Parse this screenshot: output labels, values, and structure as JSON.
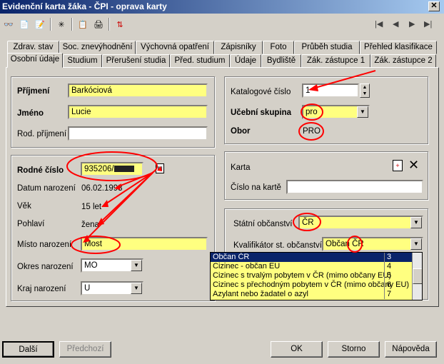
{
  "window": {
    "title": "Evidenční karta žáka - ČPI - oprava karty"
  },
  "toolbar": {
    "items": [
      "binoculars-icon",
      "copy-doc-icon",
      "edit-doc-icon",
      "asterisk-icon",
      "forms-icon",
      "print-icon",
      "swap-icon"
    ],
    "nav": [
      "|◀",
      "◀",
      "▶",
      "▶|"
    ]
  },
  "tabs": {
    "row1": [
      "Zdrav. stav",
      "Soc. znevýhodnění",
      "Výchovná opatření",
      "Zápisníky",
      "Foto",
      "Průběh studia",
      "Přehled klasifikace"
    ],
    "row2": [
      "Osobní údaje",
      "Studium",
      "Přerušení studia",
      "Před. studium",
      "Údaje",
      "Bydliště",
      "Zák. zástupce 1",
      "Zák. zástupce 2"
    ]
  },
  "name": {
    "surname_label": "Příjmení",
    "surname": "Barkóciová",
    "first_label": "Jméno",
    "first": "Lucie",
    "birthname_label": "Rod. příjmení",
    "birthname": ""
  },
  "birth": {
    "rc_label": "Rodné číslo",
    "rc": "935206/",
    "date_label": "Datum narození",
    "date": "06.02.1993",
    "age_label": "Věk",
    "age": "15 let",
    "sex_label": "Pohlaví",
    "sex": "žena",
    "place_label": "Místo narození",
    "place": "Most",
    "district_label": "Okres narození",
    "district": "MO",
    "region_label": "Kraj narození",
    "region": "U"
  },
  "catalog": {
    "num_label": "Katalogové číslo",
    "num": "1",
    "group_label": "Učební skupina",
    "group": "pro",
    "branch_label": "Obor",
    "branch": "PRO"
  },
  "card": {
    "label": "Karta",
    "num_label": "Číslo na kartě",
    "num": ""
  },
  "citizen": {
    "state_label": "Státní občanství",
    "state": "ČR",
    "qual_label": "Kvalifikátor st. občanství",
    "qual": "Občan ČR"
  },
  "dropdown": {
    "items": [
      {
        "t": "Občan ČR",
        "n": "3"
      },
      {
        "t": "Cizinec - občan EU",
        "n": "4"
      },
      {
        "t": "Cizinec s trvalým pobytem v ČR (mimo občany EU)",
        "n": "5"
      },
      {
        "t": "Cizinec s přechodným pobytem v ČR (mimo občany EU)",
        "n": "6"
      },
      {
        "t": "Azylant nebo žadatel o azyl",
        "n": "7"
      }
    ]
  },
  "buttons": {
    "next": "Další",
    "prev": "Předchozí",
    "ok": "OK",
    "cancel": "Storno",
    "help": "Nápověda"
  },
  "colors": {
    "title": "#0a246a",
    "field": "#ffff80",
    "annotation": "#ff0000"
  }
}
